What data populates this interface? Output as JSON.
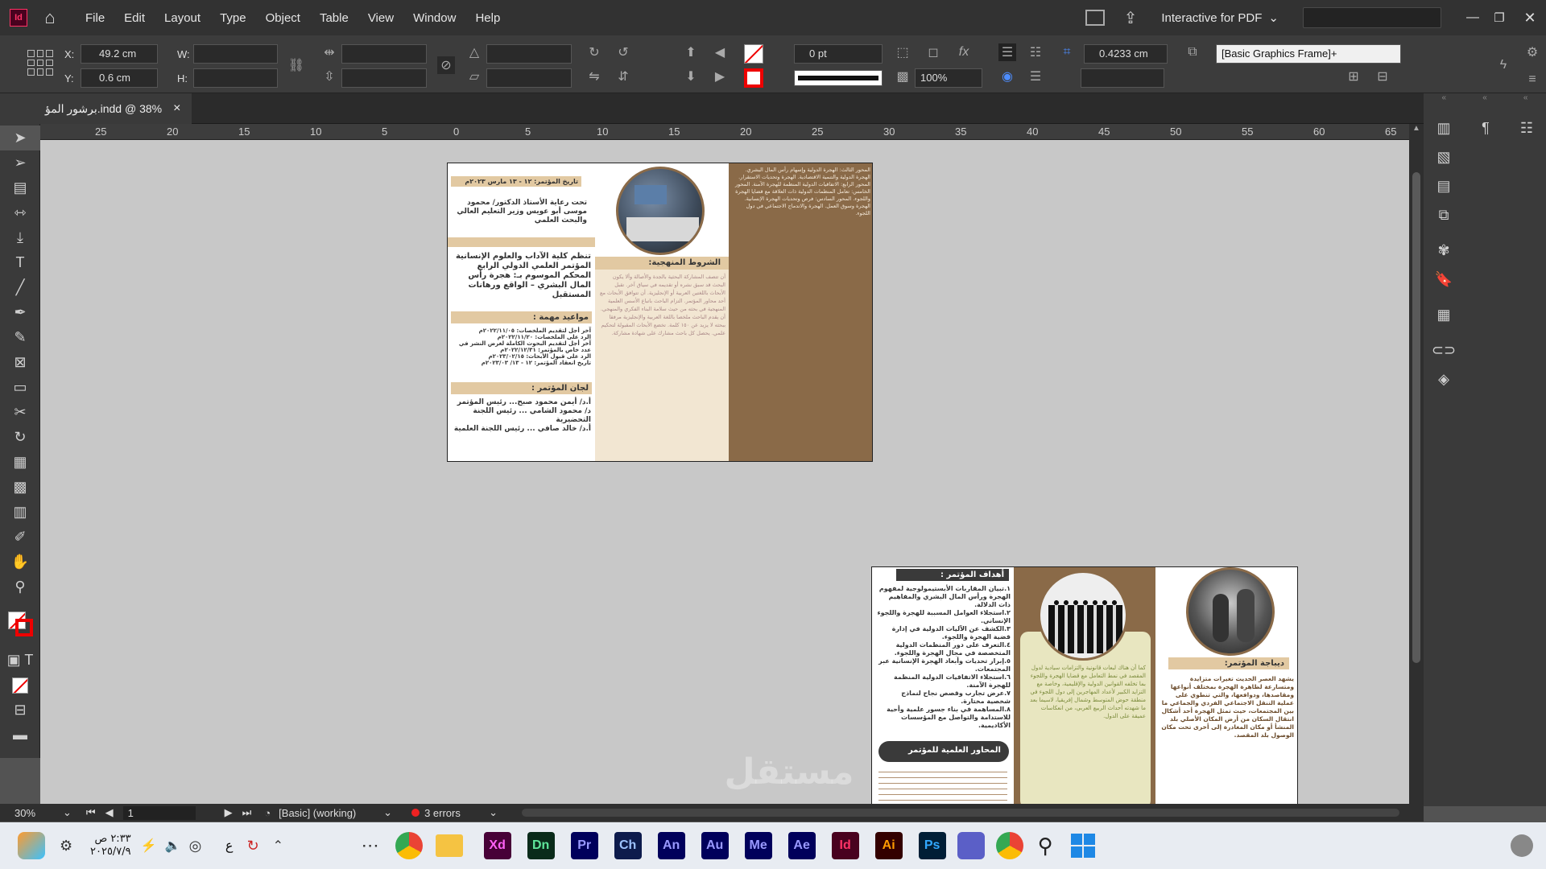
{
  "menubar": {
    "app_icon": "indesign-icon",
    "items": [
      "File",
      "Edit",
      "Layout",
      "Type",
      "Object",
      "Table",
      "View",
      "Window",
      "Help"
    ],
    "workspace": "Interactive for PDF"
  },
  "control": {
    "x_label": "X:",
    "x_value": "49.2 cm",
    "y_label": "Y:",
    "y_value": "0.6 cm",
    "w_label": "W:",
    "h_label": "H:",
    "stroke_weight": "0 pt",
    "opacity": "100%",
    "measure": "0.4233 cm",
    "object_style": "[Basic Graphics Frame]+"
  },
  "tab": {
    "title": "برشور المؤ.indd @ 38%",
    "close": "×"
  },
  "ruler": {
    "ticks": [
      "25",
      "20",
      "15",
      "10",
      "5",
      "0",
      "5",
      "10",
      "15",
      "20",
      "25",
      "30",
      "35",
      "40",
      "45",
      "50",
      "55",
      "60",
      "65"
    ]
  },
  "status": {
    "zoom": "30%",
    "page": "1",
    "style": "[Basic] (working)",
    "errors": "3 errors"
  },
  "page1": {
    "date": "تاريخ المؤتمر: ١٢ - ١٣ مارس ٢٠٢٣م",
    "patron": "تحت رعاية الأستاذ الدكتور/ محمود موسى أبو عويس وزير التعليم العالي والبحث العلمي",
    "org": "تنظم كلية الآداب والعلوم الإنسانية المؤتمر العلمي الدولي الرابع المحكم الموسوم بـ: هجرة رأس المال البشري – الواقع ورهانات المستقبل",
    "dates_head": "مواعيد مهمة :",
    "dates": [
      "آخر أجل لتقديم الملخصات: ٢٠٢٢/١١/٠٥م",
      "الرد على الملخصات: ٢٠٢٢/١١/٢٠م",
      "آخر أجل لتقديم البحوث الكاملة لغرض النشر في عدد خاص بالمؤتمر: ٢٠٢٢/١٢/٣١م",
      "الرد على قبول الأبحاث: ٢٠٢٣/٠٢/١٥م",
      "تاريخ انعقاد المؤتمر: ١٢ - ١٣/ ٢٠٢٣/٠٣م"
    ],
    "committees_head": "لجان المؤتمر :",
    "committees": [
      "أ.د/ أيمن محمود صبح... رئيس المؤتمر",
      "د/ محمود الشامي ... رئيس اللجنة التحضيرية",
      "أ.د/ خالد صافي ... رئيس اللجنة العلمية"
    ],
    "conditions_head": "الشروط المنهجية:",
    "conditions_text": "أن تتصف المشاركة البحثية بالجدة والأصالة وألا يكون البحث قد سبق نشره أو تقديمه في سياق آخر. تقبل الأبحاث باللغتين العربية أو الإنجليزية. أن تتوافق الأبحاث مع أحد محاور المؤتمر. التزام الباحث باتباع الأسس العلمية المنهجية في بحثه من حيث سلامة البناء الفكري والمنهجي. أن يقدم الباحث ملخصا باللغة العربية والإنجليزية مرفقا ببحثه لا يزيد عن ١٥٠ كلمة. تخضع الأبحاث المقبولة لتحكيم علمي. يحصل كل باحث مشارك على شهادة مشاركة.",
    "axes_text": "المحور الثالث: الهجرة الدولية وإسهام رأس المال البشري. الهجرة الدولية والتنمية الاقتصادية. الهجرة وتحديات الاستقرار. المحور الرابع: الاتفاقيات الدولية المنظمة للهجرة الآمنة. المحور الخامس: تعامل المنظمات الدولية ذات العلاقة مع قضايا الهجرة واللجوء. المحور السادس: فرص وتحديات الهجرة الإنسانية. الهجرة وسوق العمل. الهجرة والاندماج الاجتماعي في دول اللجوء."
  },
  "page2": {
    "goals_head": "أهداف المؤتمر :",
    "goals": [
      "١.تبيان المقاربات الأبستيمولوجية لمفهوم الهجرة ورأس المال البشري والمفاهيم ذات الدلالة.",
      "٢.استجلاء العوامل المسببة للهجرة واللجوء الإنساني.",
      "٣.الكشف عن الآليات الدولية في إدارة قضية الهجرة واللجوء.",
      "٤.التعرف على دور المنظمات الدولية المتخصصة في مجال الهجرة واللجوء.",
      "٥.إبراز تحديات وأبعاد الهجرة الإنسانية عبر المجتمعات.",
      "٦.استجلاء الاتفاقيات الدولية المنظمة للهجرة الآمنة.",
      "٧.عرض تجارب وقصص نجاح لنماذج شخصية مختارة.",
      "٨.المساهمة في بناء جسور علمية وأحية للاستدامة والتواصل مع المؤسسات الأكاديمية."
    ],
    "axes_head": "المحاور العلمية للمؤتمر",
    "middle_text": "كما أن هناك لبعات قانونية والتزامات سيادية لدول المقصد في نمط التعامل مع قضايا الهجرة واللجوء بما تخلفه القوانين الدولية والإقليمية، وخاصة مع التزايد الكبير لأعداد المهاجرين إلى دول اللجوء في منطقة حوض المتوسط وشمال إفريقيا، لاسيما بعد ما شهدته أحداث الربيع العربي، من انعكاسات عميقة على الدول.",
    "preamble_head": "ديباجة المؤتمر:",
    "preamble_text": "يشهد العصر الحديث تغيرات متزايدة ومتسارعة لظاهرة الهجرة بمختلف أنواعها ومقاصدها، ودوافعها، والتي تنطوي على عملية التنقل الاجتماعي الفردي والجماعي ما بين المجتمعات، حيث تمثل الهجرة أحد أشكال انتقال السكان من أرض المكان الأصلي بلد المنشأ أو مكان المغادرة إلى أخرى تحت مكان الوصول بلد المقصد."
  },
  "taskbar": {
    "time": "٢:٣٣ ص",
    "date": "٢٠٢٥/٧/٩",
    "lang": "ع",
    "apps": [
      {
        "name": "Xd",
        "bg": "#470137",
        "fg": "#ff61f6"
      },
      {
        "name": "Dn",
        "bg": "#0a2b1a",
        "fg": "#5ee59a"
      },
      {
        "name": "Pr",
        "bg": "#00005b",
        "fg": "#9999ff"
      },
      {
        "name": "Ch",
        "bg": "#0d1b4c",
        "fg": "#9dc2ff"
      },
      {
        "name": "An",
        "bg": "#00005b",
        "fg": "#9999ff"
      },
      {
        "name": "Au",
        "bg": "#00005b",
        "fg": "#9999ff"
      },
      {
        "name": "Me",
        "bg": "#00005b",
        "fg": "#9999ff"
      },
      {
        "name": "Ae",
        "bg": "#00005b",
        "fg": "#9999ff"
      },
      {
        "name": "Id",
        "bg": "#49021f",
        "fg": "#ff3366"
      },
      {
        "name": "Ai",
        "bg": "#330000",
        "fg": "#ff9a00"
      },
      {
        "name": "Ps",
        "bg": "#001e36",
        "fg": "#31a8ff"
      }
    ]
  },
  "colors": {
    "accent_brown": "#8a6a48",
    "beige": "#e2c9a2",
    "indesign": "#ff3366"
  }
}
